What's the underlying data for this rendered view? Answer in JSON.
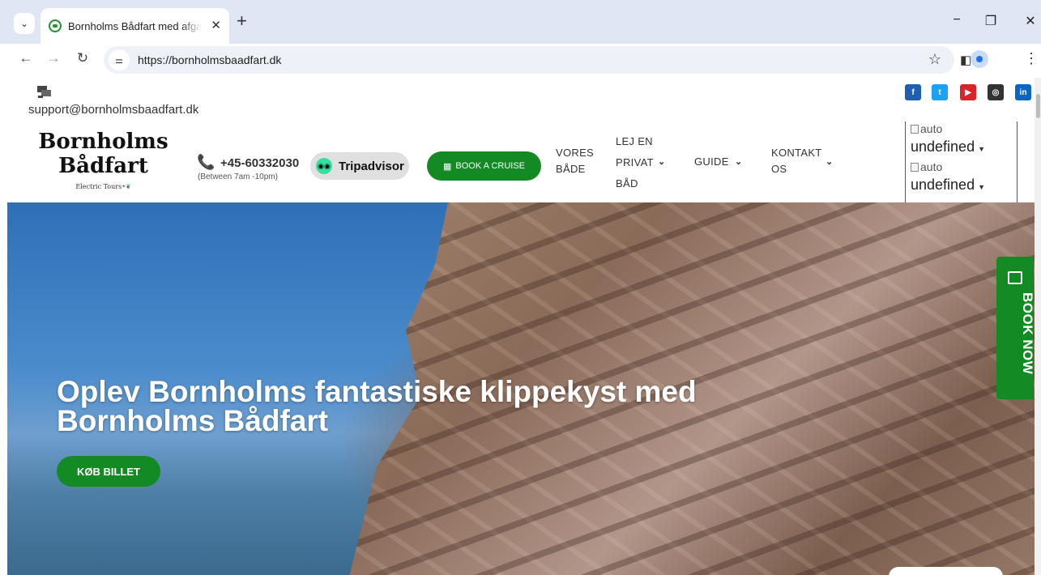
{
  "browser": {
    "tab_title": "Bornholms Bådfart med afgang",
    "url": "https://bornholmsbaadfart.dk",
    "new_tab": "+",
    "tab_close": "✕",
    "minimize": "−",
    "restore": "❐",
    "close": "✕"
  },
  "site": {
    "support_email": "support@bornholmsbaadfart.dk",
    "logo_line1": "Bornholms",
    "logo_line2": "Bådfart",
    "logo_tagline": "Electric Tours",
    "phone": "+45-60332030",
    "phone_hours": "(Between 7am -10pm)",
    "tripadvisor": "Tripadvisor",
    "book_cruise": "BOOK A CRUISE",
    "nav": {
      "vores_1": "VORES",
      "vores_2": "BÅDE",
      "lej_1": "LEJ EN",
      "lej_2": "PRIVAT",
      "lej_3": "BÅD",
      "guide": "GUIDE",
      "kontakt_1": "KONTAKT",
      "kontakt_2": "OS"
    },
    "lang": {
      "img_alt_1": "auto",
      "value_1": "undefined",
      "img_alt_2": "auto",
      "value_2": "undefined"
    },
    "social": {
      "facebook": "f",
      "twitter": "t",
      "youtube": "▶",
      "instagram": "◎",
      "linkedin": "in"
    }
  },
  "hero": {
    "title_line1": "Oplev Bornholms fantastiske klippekyst med",
    "title_line2": "Bornholms Bådfart",
    "cta": "KØB BILLET",
    "book_now": "BOOK NOW"
  }
}
